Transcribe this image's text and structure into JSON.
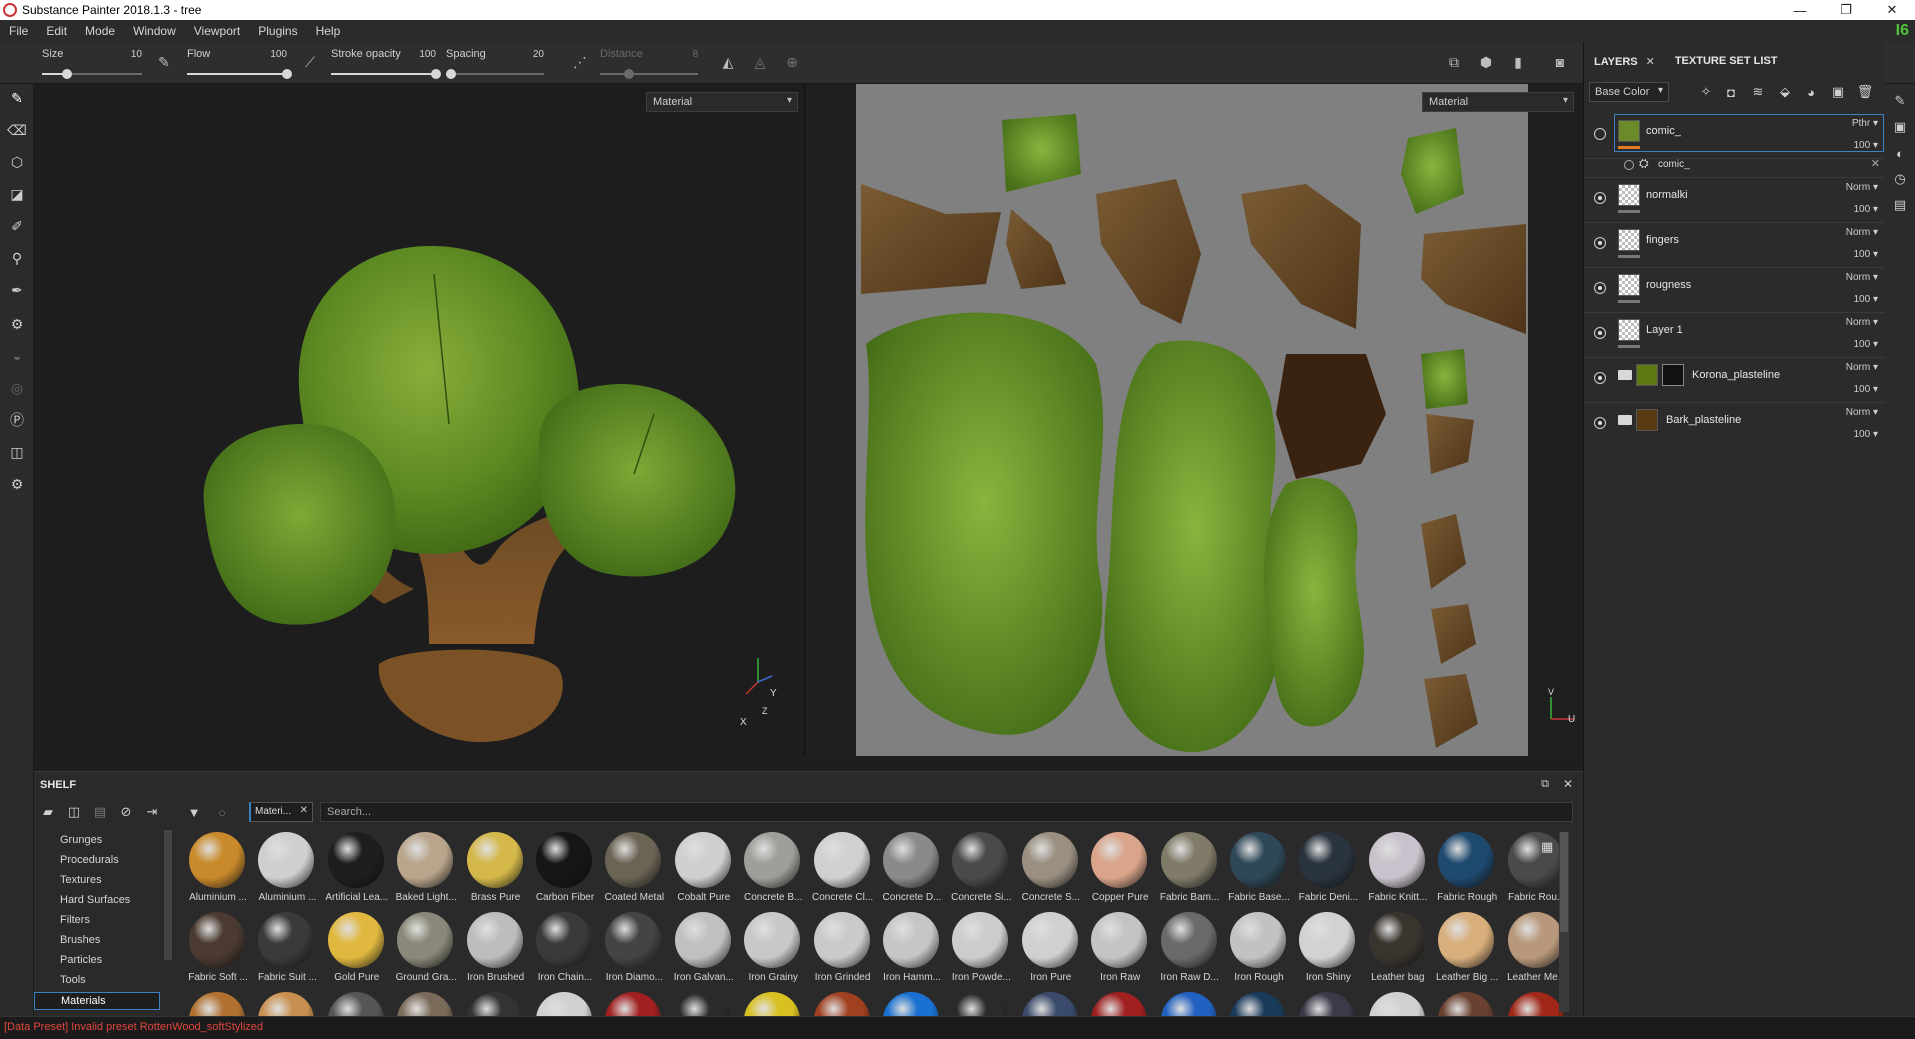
{
  "window": {
    "title": "Substance Painter 2018.1.3 - tree",
    "minimize": "—",
    "maximize": "❐",
    "close": "✕"
  },
  "menu": [
    "File",
    "Edit",
    "Mode",
    "Window",
    "Viewport",
    "Plugins",
    "Help"
  ],
  "version_badge": "I6",
  "toolbar": {
    "size": {
      "label": "Size",
      "value": "10",
      "level": 0.25
    },
    "flow": {
      "label": "Flow",
      "value": "100",
      "level": 1.0
    },
    "stroke_opacity": {
      "label": "Stroke opacity",
      "value": "100",
      "level": 1.0
    },
    "spacing": {
      "label": "Spacing",
      "value": "20",
      "level": 0.05
    },
    "distance": {
      "label": "Distance",
      "value": "8",
      "level": 0.3
    }
  },
  "viewport3d": {
    "mode": "Material",
    "axis_x": "X",
    "axis_y": "Y",
    "axis_z": "Z"
  },
  "viewport2d": {
    "mode": "Material",
    "axis_v": "V",
    "axis_u": "U"
  },
  "layers_panel": {
    "tab_layers": "LAYERS",
    "tab_texture_sets": "TEXTURE SET LIST",
    "channel": "Base Color",
    "layers": [
      {
        "name": "comic_",
        "blend": "Pthr",
        "opacity": "100",
        "thumb": "#6b8a2a",
        "selected": true,
        "type": "paint"
      },
      {
        "name": "normalki",
        "blend": "Norm",
        "opacity": "100",
        "thumb": "checker",
        "type": "paint"
      },
      {
        "name": "fingers",
        "blend": "Norm",
        "opacity": "100",
        "thumb": "checker",
        "type": "paint"
      },
      {
        "name": "rougness",
        "blend": "Norm",
        "opacity": "100",
        "thumb": "checker",
        "type": "paint"
      },
      {
        "name": "Layer 1",
        "blend": "Norm",
        "opacity": "100",
        "thumb": "checker",
        "type": "paint"
      },
      {
        "name": "Korona_plasteline",
        "blend": "Norm",
        "opacity": "100",
        "thumb": "#5f7a12",
        "type": "folder"
      },
      {
        "name": "Bark_plasteline",
        "blend": "Norm",
        "opacity": "100",
        "thumb": "#5a3a12",
        "type": "folder"
      }
    ],
    "sublayer": {
      "name": "comic_"
    }
  },
  "shelf": {
    "title": "SHELF",
    "filter_chip": "Materi...",
    "search_placeholder": "Search...",
    "categories": [
      "Grunges",
      "Procedurals",
      "Textures",
      "Hard Surfaces",
      "Filters",
      "Brushes",
      "Particles",
      "Tools",
      "Materials"
    ],
    "selected_category": "Materials",
    "materials_row1": [
      {
        "name": "Aluminium ...",
        "color": "#c88a2a"
      },
      {
        "name": "Aluminium ...",
        "color": "#cfcfcf"
      },
      {
        "name": "Artificial Lea...",
        "color": "#1e1e1e"
      },
      {
        "name": "Baked Light...",
        "color": "#b9a58c"
      },
      {
        "name": "Brass Pure",
        "color": "#d4b84a"
      },
      {
        "name": "Carbon Fiber",
        "color": "#161616"
      },
      {
        "name": "Coated Metal",
        "color": "#6b6455"
      },
      {
        "name": "Cobalt Pure",
        "color": "#cfcfcf"
      },
      {
        "name": "Concrete B...",
        "color": "#9e9e9a"
      },
      {
        "name": "Concrete Cl...",
        "color": "#d0d0d0"
      },
      {
        "name": "Concrete D...",
        "color": "#8a8a88"
      },
      {
        "name": "Concrete Si...",
        "color": "#4a4a4a"
      },
      {
        "name": "Concrete S...",
        "color": "#9a8f80"
      },
      {
        "name": "Copper Pure",
        "color": "#d9a48a"
      },
      {
        "name": "Fabric Bam...",
        "color": "#807a68"
      },
      {
        "name": "Fabric Base...",
        "color": "#2f4858"
      },
      {
        "name": "Fabric Deni...",
        "color": "#2a3440"
      },
      {
        "name": "Fabric Knitt...",
        "color": "#c9c2cc"
      },
      {
        "name": "Fabric Rough",
        "color": "#1f4a70"
      },
      {
        "name": "Fabric Rou...",
        "color": "#4a4a4a"
      }
    ],
    "materials_row2": [
      {
        "name": "Fabric Soft ...",
        "color": "#4a3a30"
      },
      {
        "name": "Fabric Suit ...",
        "color": "#3a3a3a"
      },
      {
        "name": "Gold Pure",
        "color": "#e0b840"
      },
      {
        "name": "Ground Gra...",
        "color": "#8a8878"
      },
      {
        "name": "Iron Brushed",
        "color": "#bdbdbd"
      },
      {
        "name": "Iron Chain...",
        "color": "#3a3a3a"
      },
      {
        "name": "Iron Diamo...",
        "color": "#444"
      },
      {
        "name": "Iron Galvan...",
        "color": "#c0c0c0"
      },
      {
        "name": "Iron Grainy",
        "color": "#c8c8c8"
      },
      {
        "name": "Iron Grinded",
        "color": "#cacaca"
      },
      {
        "name": "Iron Hamm...",
        "color": "#c6c6c6"
      },
      {
        "name": "Iron Powde...",
        "color": "#cccccc"
      },
      {
        "name": "Iron Pure",
        "color": "#d0d0d0"
      },
      {
        "name": "Iron Raw",
        "color": "#c4c4c4"
      },
      {
        "name": "Iron Raw D...",
        "color": "#6a6a6a"
      },
      {
        "name": "Iron Rough",
        "color": "#c2c2c2"
      },
      {
        "name": "Iron Shiny",
        "color": "#d2d2d2"
      },
      {
        "name": "Leather bag",
        "color": "#3a342e"
      },
      {
        "name": "Leather Big ...",
        "color": "#d8ae7c"
      },
      {
        "name": "Leather Me...",
        "color": "#b8987a"
      }
    ],
    "materials_row3_colors": [
      "#b07030",
      "#c89050",
      "#555555",
      "#7a6a5a",
      "#333333",
      "#d0d0d0",
      "#a02020",
      "#2a2a2a",
      "#d8c020",
      "#a04020",
      "#1a70d0",
      "#2a2a2a",
      "#3a4a6a",
      "#a02020",
      "#2060c0",
      "#1a3a5a",
      "#3a3a4a",
      "#d0d0d0",
      "#6a4030",
      "#a02818"
    ]
  },
  "status": "[Data Preset] Invalid preset RottenWood_softStylized",
  "colors": {
    "accent": "#3b82c4",
    "error": "#e0473d",
    "version_green": "#4fc03a"
  }
}
